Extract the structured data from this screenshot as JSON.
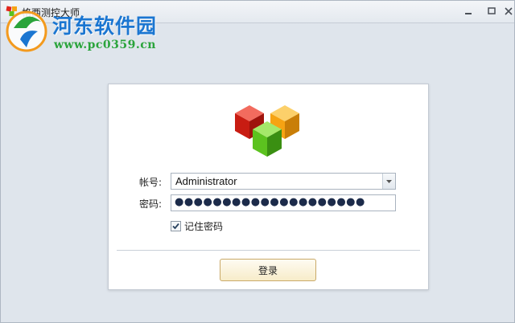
{
  "window": {
    "title": "格西测控大师",
    "controls": {
      "minimize": "minimize-icon",
      "maximize": "maximize-icon",
      "close": "close-icon"
    }
  },
  "watermark": {
    "site_name": "河东软件园",
    "url": "www.pc0359.cn"
  },
  "login": {
    "logo_icon": "three-cubes-logo-icon",
    "account_label": "帐号:",
    "account_value": "Administrator",
    "password_label": "密码:",
    "password_value": "●●●●●●●●●●●●●●●●●●●●",
    "remember_label": "记住密码",
    "remember_checked": true,
    "login_button": "登录"
  },
  "colors": {
    "accent_blue": "#1b76d1",
    "accent_green": "#2aa43b",
    "cube_red": "#e1251b",
    "cube_orange": "#f6a313",
    "cube_green": "#5cc21f"
  }
}
